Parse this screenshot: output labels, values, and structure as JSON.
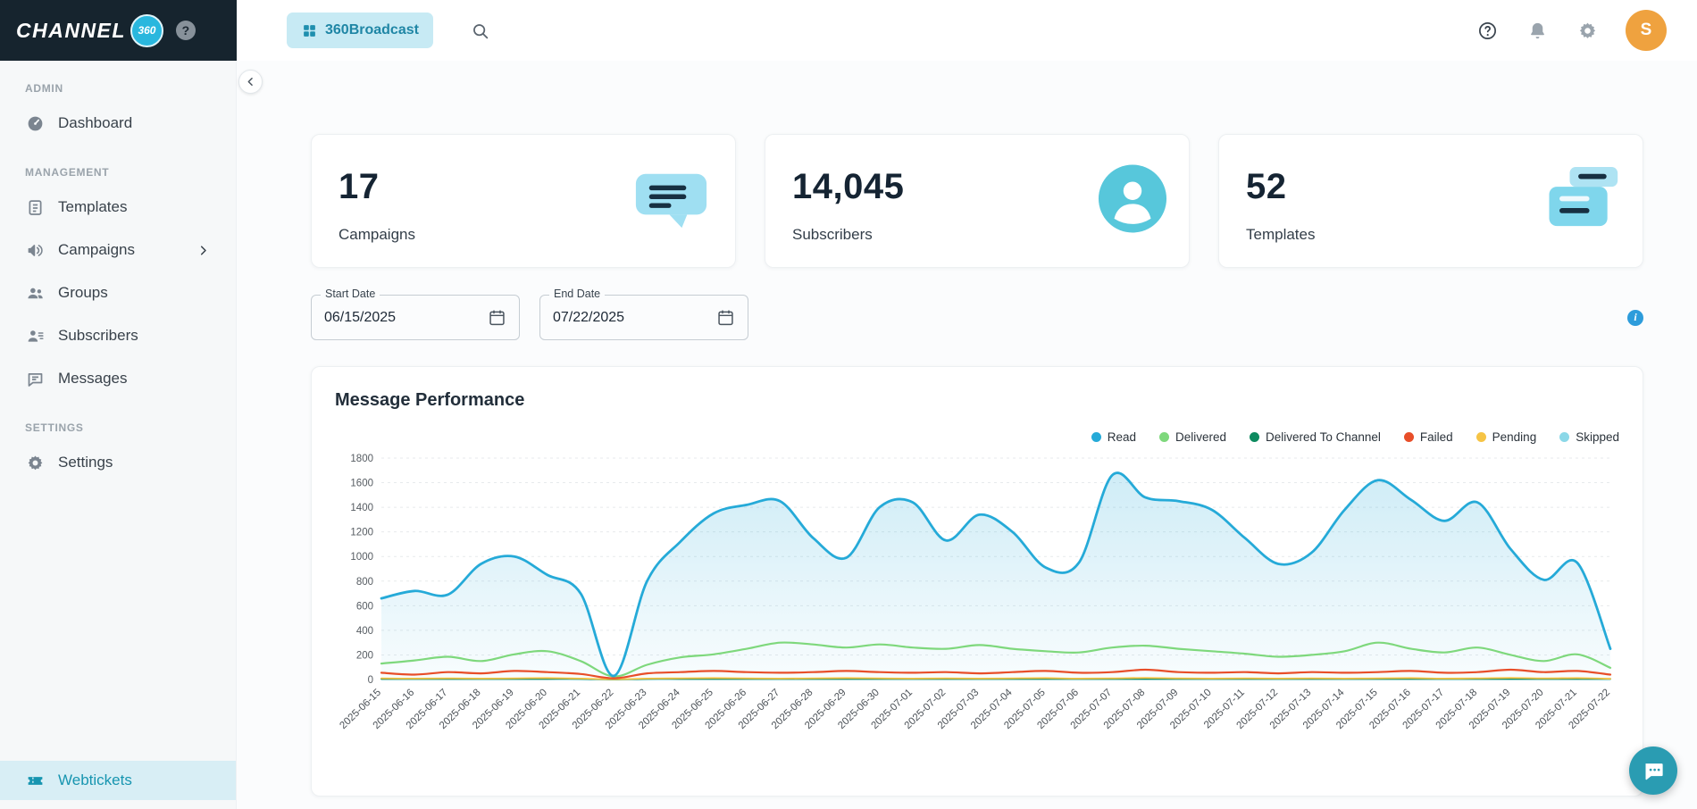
{
  "logo": {
    "text": "CHANNEL",
    "badge": "360",
    "help": "?"
  },
  "header": {
    "app_chip": {
      "label": "360Broadcast",
      "icon": "broadcast-icon"
    },
    "avatar_initial": "S"
  },
  "sidebar": {
    "sections": [
      {
        "label": "ADMIN",
        "items": [
          {
            "label": "Dashboard",
            "icon": "dashboard-icon"
          }
        ]
      },
      {
        "label": "MANAGEMENT",
        "items": [
          {
            "label": "Templates",
            "icon": "templates-icon"
          },
          {
            "label": "Campaigns",
            "icon": "campaigns-icon",
            "chevron": true
          },
          {
            "label": "Groups",
            "icon": "groups-icon"
          },
          {
            "label": "Subscribers",
            "icon": "subscribers-icon"
          },
          {
            "label": "Messages",
            "icon": "messages-icon"
          }
        ]
      },
      {
        "label": "SETTINGS",
        "items": [
          {
            "label": "Settings",
            "icon": "settings-icon"
          }
        ]
      }
    ],
    "bottom_item": {
      "label": "Webtickets",
      "icon": "webtickets-icon"
    }
  },
  "stats": [
    {
      "value": "17",
      "label": "Campaigns",
      "icon": "campaign-bubble-icon"
    },
    {
      "value": "14,045",
      "label": "Subscribers",
      "icon": "subscriber-avatar-icon"
    },
    {
      "value": "52",
      "label": "Templates",
      "icon": "template-cards-icon"
    }
  ],
  "filters": {
    "start_date": {
      "label": "Start Date",
      "value": "06/15/2025"
    },
    "end_date": {
      "label": "End Date",
      "value": "07/22/2025"
    }
  },
  "chart_card": {
    "title": "Message Performance"
  },
  "chart_data": {
    "type": "line",
    "title": "Message Performance",
    "legend_position": "top-right",
    "grid": "horizontal-dashed",
    "ylim": [
      0,
      1800
    ],
    "yticks": [
      0,
      200,
      400,
      600,
      800,
      1000,
      1200,
      1400,
      1600,
      1800
    ],
    "x": [
      "2025-06-15",
      "2025-06-16",
      "2025-06-17",
      "2025-06-18",
      "2025-06-19",
      "2025-06-20",
      "2025-06-21",
      "2025-06-22",
      "2025-06-23",
      "2025-06-24",
      "2025-06-25",
      "2025-06-26",
      "2025-06-27",
      "2025-06-28",
      "2025-06-29",
      "2025-06-30",
      "2025-07-01",
      "2025-07-02",
      "2025-07-03",
      "2025-07-04",
      "2025-07-05",
      "2025-07-06",
      "2025-07-07",
      "2025-07-08",
      "2025-07-09",
      "2025-07-10",
      "2025-07-11",
      "2025-07-12",
      "2025-07-13",
      "2025-07-14",
      "2025-07-15",
      "2025-07-16",
      "2025-07-17",
      "2025-07-18",
      "2025-07-19",
      "2025-07-20",
      "2025-07-21",
      "2025-07-22"
    ],
    "series": [
      {
        "name": "Read",
        "color": "#25aad8",
        "area": true,
        "stroke_width": 2.8,
        "values": [
          660,
          720,
          690,
          940,
          1000,
          850,
          700,
          30,
          800,
          1120,
          1350,
          1420,
          1450,
          1150,
          990,
          1400,
          1440,
          1130,
          1340,
          1200,
          910,
          950,
          1660,
          1480,
          1450,
          1380,
          1150,
          940,
          1030,
          1380,
          1620,
          1460,
          1290,
          1440,
          1060,
          810,
          950,
          250
        ]
      },
      {
        "name": "Delivered",
        "color": "#7ed87c",
        "stroke_width": 2.2,
        "values": [
          130,
          155,
          185,
          150,
          205,
          230,
          150,
          25,
          120,
          180,
          205,
          250,
          300,
          285,
          260,
          285,
          260,
          250,
          280,
          250,
          230,
          220,
          260,
          275,
          250,
          230,
          210,
          185,
          200,
          230,
          300,
          250,
          220,
          260,
          200,
          150,
          205,
          95
        ]
      },
      {
        "name": "Delivered To Channel",
        "color": "#0d8a5f",
        "stroke_width": 1.8,
        "values": [
          5,
          5,
          5,
          5,
          5,
          5,
          5,
          0,
          5,
          5,
          5,
          5,
          5,
          5,
          5,
          5,
          5,
          5,
          5,
          5,
          5,
          5,
          5,
          5,
          5,
          5,
          5,
          5,
          5,
          5,
          5,
          5,
          5,
          5,
          5,
          5,
          5,
          5
        ]
      },
      {
        "name": "Failed",
        "color": "#e84e29",
        "stroke_width": 2.2,
        "values": [
          55,
          40,
          60,
          50,
          70,
          60,
          45,
          10,
          50,
          60,
          70,
          60,
          55,
          60,
          70,
          60,
          55,
          60,
          50,
          60,
          70,
          55,
          60,
          80,
          60,
          55,
          60,
          50,
          60,
          55,
          60,
          70,
          55,
          60,
          80,
          60,
          70,
          40
        ]
      },
      {
        "name": "Pending",
        "color": "#f6c445",
        "stroke_width": 1.8,
        "values": [
          10,
          8,
          10,
          8,
          10,
          12,
          8,
          2,
          8,
          10,
          12,
          10,
          8,
          10,
          12,
          10,
          8,
          10,
          8,
          10,
          12,
          8,
          10,
          14,
          10,
          8,
          10,
          8,
          10,
          8,
          10,
          12,
          8,
          10,
          14,
          10,
          12,
          6
        ]
      },
      {
        "name": "Skipped",
        "color": "#8bd8e8",
        "stroke_width": 1.8,
        "values": [
          2,
          2,
          2,
          2,
          2,
          2,
          2,
          0,
          2,
          2,
          2,
          2,
          2,
          2,
          2,
          2,
          2,
          2,
          2,
          2,
          2,
          2,
          2,
          2,
          2,
          2,
          2,
          2,
          2,
          2,
          2,
          2,
          2,
          2,
          2,
          2,
          2,
          2
        ]
      }
    ]
  },
  "colors": {
    "accent": "#29b7de",
    "sidebar_active_bg": "#d8eef5",
    "sidebar_active_text": "#1795b0",
    "avatar": "#efa23f",
    "info": "#2d9cdb",
    "chat_widget": "#2a9cb2"
  }
}
